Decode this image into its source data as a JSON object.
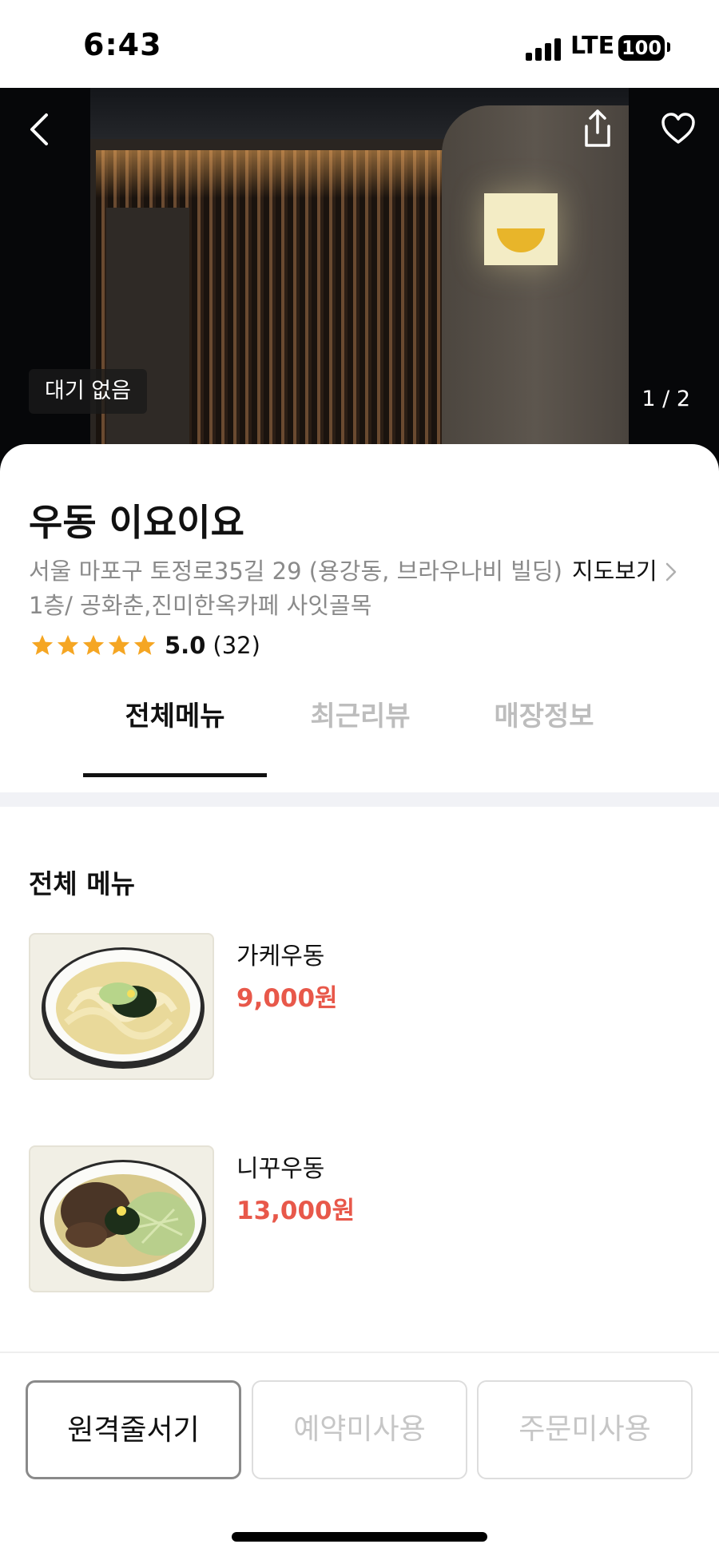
{
  "status_bar": {
    "time": "6:43",
    "network": "LTE",
    "battery": "100"
  },
  "hero": {
    "wait_badge": "대기 없음",
    "photo_counter": "1 / 2"
  },
  "store": {
    "name": "우동 이요이요",
    "address": "서울 마포구 토정로35길 29 (용강동, 브라우나비 빌딩) 1층/ 공화춘,진미한옥카페 사잇골목",
    "map_link": "지도보기",
    "rating": {
      "stars": 5,
      "score": "5.0",
      "count": "(32)",
      "star_color": "#f5a623"
    }
  },
  "tabs": [
    {
      "label": "전체메뉴",
      "active": true
    },
    {
      "label": "최근리뷰",
      "active": false
    },
    {
      "label": "매장정보",
      "active": false
    }
  ],
  "menu": {
    "heading": "전체 메뉴",
    "items": [
      {
        "name": "가케우동",
        "price": "9,000원"
      },
      {
        "name": "니꾸우동",
        "price": "13,000원"
      }
    ]
  },
  "actions": [
    {
      "label": "원격줄서기",
      "enabled": true
    },
    {
      "label": "예약미사용",
      "enabled": false
    },
    {
      "label": "주문미사용",
      "enabled": false
    }
  ],
  "colors": {
    "price": "#e8584a",
    "accent_star": "#f5a623",
    "divider": "#f1f2f6"
  },
  "icons": [
    "back-arrow-icon",
    "share-icon",
    "heart-icon",
    "chevron-right-icon",
    "star-icon"
  ]
}
